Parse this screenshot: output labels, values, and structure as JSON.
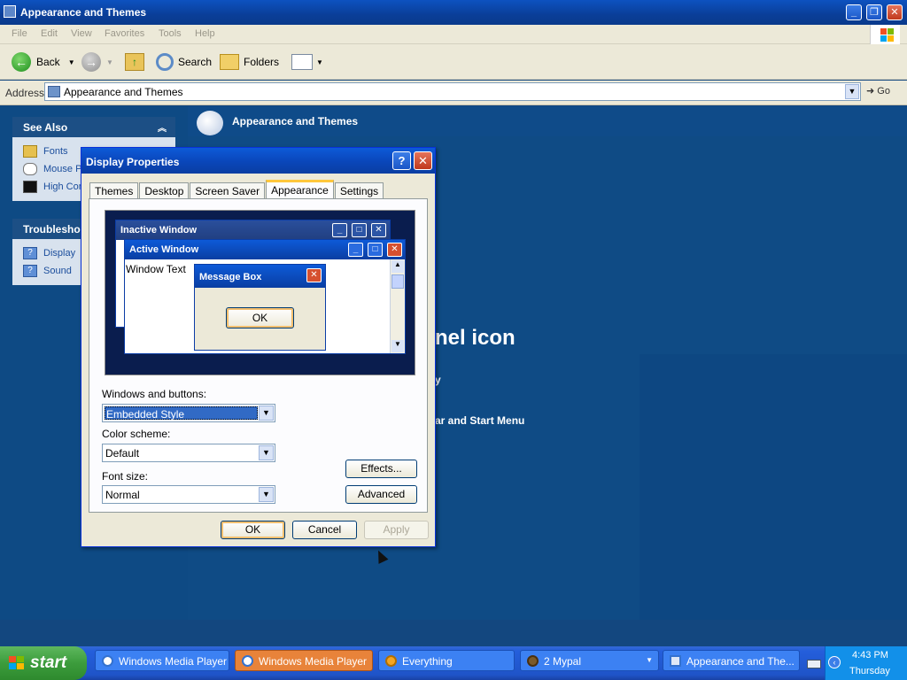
{
  "window": {
    "title": "Appearance and Themes",
    "menu": [
      "File",
      "Edit",
      "View",
      "Favorites",
      "Tools",
      "Help"
    ],
    "toolbar": {
      "back": "Back",
      "search": "Search",
      "folders": "Folders"
    },
    "address": {
      "label": "Address",
      "value": "Appearance and Themes",
      "go": "Go"
    }
  },
  "left_pane": {
    "see_also": {
      "title": "See Also",
      "items": [
        "Fonts",
        "Mouse P",
        "High Con"
      ]
    },
    "troubleshooters": {
      "title": "Troublesho",
      "items": [
        "Display",
        "Sound"
      ]
    }
  },
  "right_pane": {
    "title": "Appearance and Themes",
    "partial_heading": "nel icon",
    "partial_links": [
      "y",
      "ar and Start Menu"
    ]
  },
  "dialog": {
    "title": "Display Properties",
    "tabs": [
      "Themes",
      "Desktop",
      "Screen Saver",
      "Appearance",
      "Settings"
    ],
    "active_tab": "Appearance",
    "preview": {
      "inactive_title": "Inactive Window",
      "active_title": "Active Window",
      "window_text": "Window Text",
      "message_title": "Message Box",
      "message_ok": "OK"
    },
    "windows_buttons_label": "Windows and buttons:",
    "windows_buttons_value": "Embedded Style",
    "color_scheme_label": "Color scheme:",
    "color_scheme_value": "Default",
    "font_size_label": "Font size:",
    "font_size_value": "Normal",
    "effects": "Effects...",
    "advanced": "Advanced",
    "ok": "OK",
    "cancel": "Cancel",
    "apply": "Apply"
  },
  "taskbar": {
    "start": "start",
    "tasks": [
      "Windows Media Player",
      "Windows Media Player",
      "Everything",
      "2 Mypal",
      "Appearance and The..."
    ],
    "active_task_index": 1,
    "time": "4:43 PM",
    "day": "Thursday"
  },
  "colors": {
    "desktop_blue": "#13477f",
    "title_blue": "#0a46b9",
    "active_task_orange": "#e8833a",
    "start_green": "#3c9c3c"
  }
}
